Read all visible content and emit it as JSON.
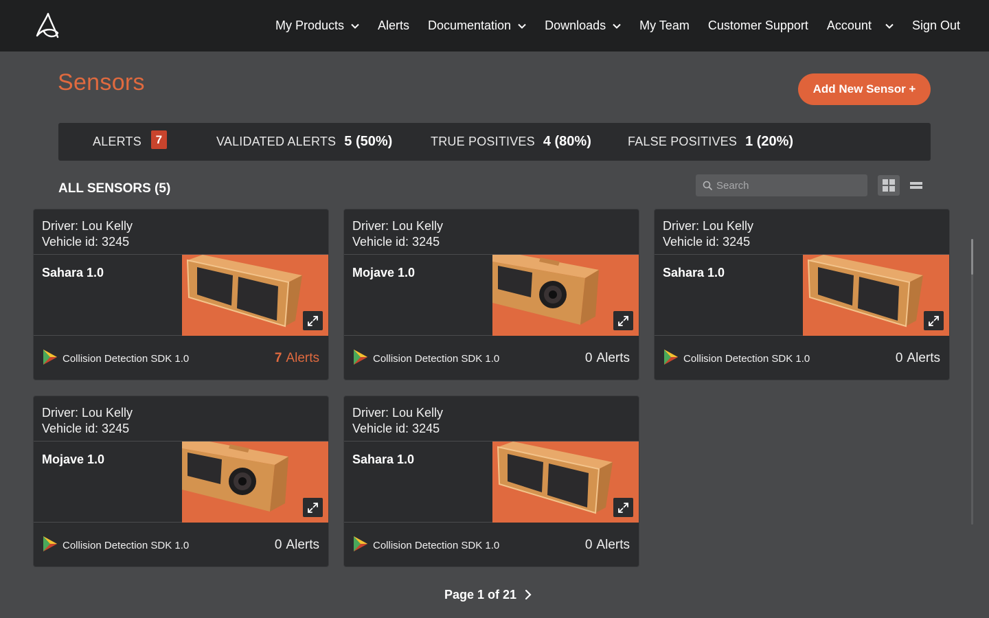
{
  "nav": {
    "logo_icon": "app-logo-icon",
    "items": [
      {
        "label": "My Products",
        "dropdown": true
      },
      {
        "label": "Alerts",
        "dropdown": false
      },
      {
        "label": "Documentation",
        "dropdown": true
      },
      {
        "label": "Downloads",
        "dropdown": true
      },
      {
        "label": "My Team",
        "dropdown": false
      },
      {
        "label": "Customer Support",
        "dropdown": false
      },
      {
        "label": "Account",
        "dropdown": true
      },
      {
        "label": "Sign Out",
        "dropdown": false
      }
    ]
  },
  "header": {
    "title": "Sensors",
    "add_button": "Add New Sensor +"
  },
  "stats": {
    "alerts_label": "ALERTS",
    "alerts_count": "7",
    "validated_label": "VALIDATED ALERTS",
    "validated_value": "5 (50%)",
    "true_pos_label": "TRUE POSITIVES",
    "true_pos_value": "4 (80%)",
    "false_pos_label": "FALSE POSITIVES",
    "false_pos_value": "1 (20%)"
  },
  "list": {
    "title": "ALL SENSORS (5)",
    "search_placeholder": "Search",
    "view": "grid"
  },
  "cards": [
    {
      "driver": "Driver: Lou Kelly",
      "vehicle": "Vehicle id: 3245",
      "model": "Sahara 1.0",
      "sdk": "Collision Detection SDK 1.0",
      "alerts_num": "7",
      "alerts_label": "Alerts",
      "highlight": true
    },
    {
      "driver": "Driver: Lou Kelly",
      "vehicle": "Vehicle id: 3245",
      "model": "Mojave 1.0",
      "sdk": "Collision Detection SDK 1.0",
      "alerts_num": "0",
      "alerts_label": "Alerts",
      "highlight": false
    },
    {
      "driver": "Driver: Lou Kelly",
      "vehicle": "Vehicle id: 3245",
      "model": "Sahara 1.0",
      "sdk": "Collision Detection SDK 1.0",
      "alerts_num": "0",
      "alerts_label": "Alerts",
      "highlight": false
    },
    {
      "driver": "Driver: Lou Kelly",
      "vehicle": "Vehicle id: 3245",
      "model": "Mojave 1.0",
      "sdk": "Collision Detection SDK 1.0",
      "alerts_num": "0",
      "alerts_label": "Alerts",
      "highlight": false
    },
    {
      "driver": "Driver: Lou Kelly",
      "vehicle": "Vehicle id: 3245",
      "model": "Sahara 1.0",
      "sdk": "Collision Detection SDK 1.0",
      "alerts_num": "0",
      "alerts_label": "Alerts",
      "highlight": false
    }
  ],
  "pager": {
    "label": "Page 1 of 21"
  },
  "colors": {
    "accent": "#e06a3f",
    "badge": "#c8442d",
    "nav_bg": "#1f2021",
    "page_bg": "#48494b",
    "card_bg": "#2b2c2e"
  }
}
